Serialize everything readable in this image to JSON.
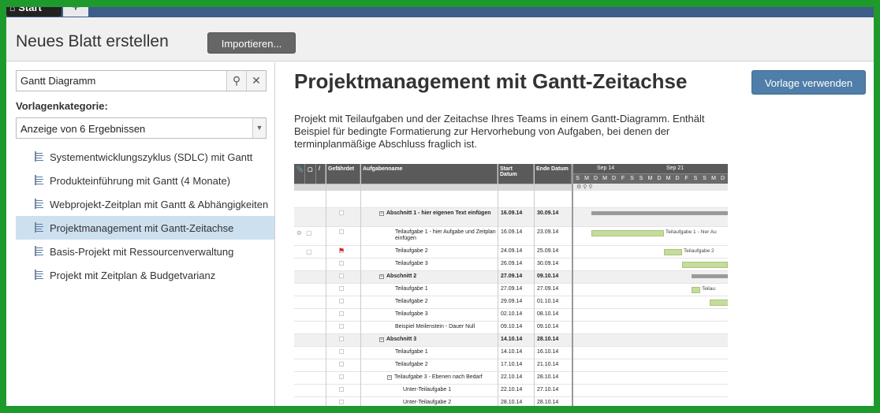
{
  "tabs": {
    "start_label": "Start",
    "add_icon": "plus-icon"
  },
  "header": {
    "title": "Neues Blatt erstellen",
    "import_label": "Importieren..."
  },
  "sidebar": {
    "search_value": "Gantt Diagramm",
    "category_label": "Vorlagenkategorie:",
    "category_select": "Anzeige von 6 Ergebnissen",
    "templates": [
      {
        "label": "Systementwicklungszyklus (SDLC) mit Gantt",
        "selected": false
      },
      {
        "label": "Produkteinführung mit Gantt (4 Monate)",
        "selected": false
      },
      {
        "label": "Webprojekt-Zeitplan mit Gantt & Abhängigkeiten",
        "selected": false
      },
      {
        "label": "Projektmanagement mit Gantt-Zeitachse",
        "selected": true
      },
      {
        "label": "Basis-Projekt mit Ressourcenverwaltung",
        "selected": false
      },
      {
        "label": "Projekt mit Zeitplan & Budgetvarianz",
        "selected": false
      }
    ]
  },
  "main": {
    "title": "Projektmanagement mit Gantt-Zeitachse",
    "use_template_label": "Vorlage verwenden",
    "description": "Projekt mit Teilaufgaben und der Zeitachse Ihres Teams in einem Gantt-Diagramm. Enthält Beispiel für bedingte Formatierung zur Hervorhebung von Aufgaben, bei denen der terminplanmäßige Abschluss fraglich ist."
  },
  "preview": {
    "columns": {
      "at_risk": "Gefährdet",
      "task": "Aufgabenname",
      "start": "Start Datum",
      "end": "Ende Datum"
    },
    "weeks": [
      "Sep 14",
      "Sep 21"
    ],
    "days": [
      "S",
      "M",
      "D",
      "M",
      "D",
      "F",
      "S",
      "S",
      "M",
      "D",
      "M",
      "D",
      "F",
      "S",
      "S",
      "M",
      "D"
    ],
    "rows": [
      {
        "name": "",
        "start": "",
        "end": "",
        "type": "blank"
      },
      {
        "name": "Abschnitt 1 - hier eigenen Text einfügen",
        "start": "16.09.14",
        "end": "30.09.14",
        "type": "section",
        "indent": 0
      },
      {
        "name": "Teilaufgabe 1 - hier Aufgabe und Zeitplan einfügen",
        "start": "16.09.14",
        "end": "23.09.14",
        "type": "task",
        "indent": 1,
        "bar_label": "Teilaufgabe 1 - hier Au"
      },
      {
        "name": "Teilaufgabe 2",
        "start": "24.09.14",
        "end": "25.09.14",
        "type": "task",
        "indent": 1,
        "flag": true,
        "bar_label": "Teilaufgabe 2"
      },
      {
        "name": "Teilaufgabe 3",
        "start": "26.09.14",
        "end": "30.09.14",
        "type": "task",
        "indent": 1
      },
      {
        "name": "Abschnitt 2",
        "start": "27.09.14",
        "end": "09.10.14",
        "type": "section",
        "indent": 0
      },
      {
        "name": "Teilaufgabe 1",
        "start": "27.09.14",
        "end": "27.09.14",
        "type": "task",
        "indent": 1,
        "bar_label": "Teilau"
      },
      {
        "name": "Teilaufgabe 2",
        "start": "29.09.14",
        "end": "01.10.14",
        "type": "task",
        "indent": 1
      },
      {
        "name": "Teilaufgabe 3",
        "start": "02.10.14",
        "end": "08.10.14",
        "type": "task",
        "indent": 1
      },
      {
        "name": "Beispiel Meilenstein - Dauer Null",
        "start": "09.10.14",
        "end": "09.10.14",
        "type": "task",
        "indent": 1
      },
      {
        "name": "Abschnitt 3",
        "start": "14.10.14",
        "end": "28.10.14",
        "type": "section",
        "indent": 0
      },
      {
        "name": "Teilaufgabe 1",
        "start": "14.10.14",
        "end": "16.10.14",
        "type": "task",
        "indent": 1
      },
      {
        "name": "Teilaufgabe 2",
        "start": "17.10.14",
        "end": "21.10.14",
        "type": "task",
        "indent": 1
      },
      {
        "name": "Teilaufgabe 3 - Ebenen nach Bedarf",
        "start": "22.10.14",
        "end": "28.10.14",
        "type": "task",
        "indent": 1,
        "collapsible": true
      },
      {
        "name": "Unter-Teilaufgabe 1",
        "start": "22.10.14",
        "end": "27.10.14",
        "type": "task",
        "indent": 2
      },
      {
        "name": "Unter-Teilaufgabe 2",
        "start": "28.10.14",
        "end": "28.10.14",
        "type": "task",
        "indent": 2
      }
    ]
  },
  "colors": {
    "frame": "#1e9a2c",
    "topbar": "#3d5d8a",
    "accent_button": "#4f7ea8",
    "selected_row": "#cde0f0"
  }
}
